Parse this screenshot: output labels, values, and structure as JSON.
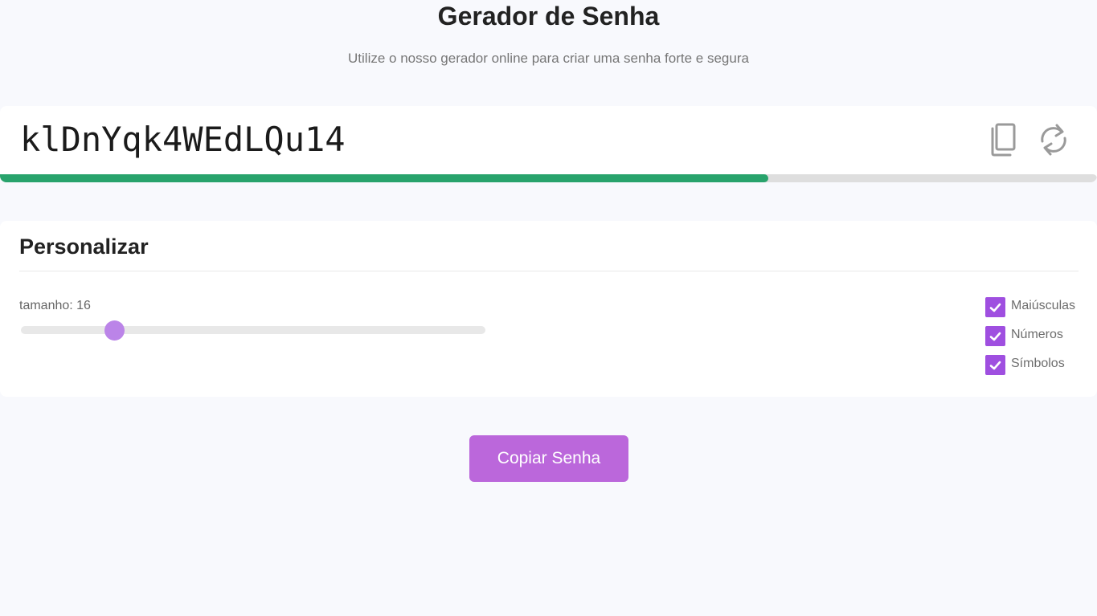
{
  "header": {
    "title": "Gerador de Senha",
    "subtitle": "Utilize o nosso gerador online para criar uma senha forte e segura"
  },
  "password": {
    "value": "klDnYqk4WEdLQu14",
    "strength_fraction": 0.7,
    "copy_icon": "copy-icon",
    "refresh_icon": "refresh-icon"
  },
  "customize": {
    "title": "Personalizar",
    "size_label": "tamanho: 16",
    "size_value": 16,
    "size_min": 4,
    "size_max": 64,
    "options": [
      {
        "label": "Maiúsculas",
        "checked": true
      },
      {
        "label": "Números",
        "checked": true
      },
      {
        "label": "Símbolos",
        "checked": true
      }
    ]
  },
  "actions": {
    "copy_button": "Copiar Senha"
  },
  "colors": {
    "strength": "#28a36c",
    "accent": "#9f4fe0",
    "slider_thumb": "#bb84e8",
    "button": "#bb67db"
  }
}
